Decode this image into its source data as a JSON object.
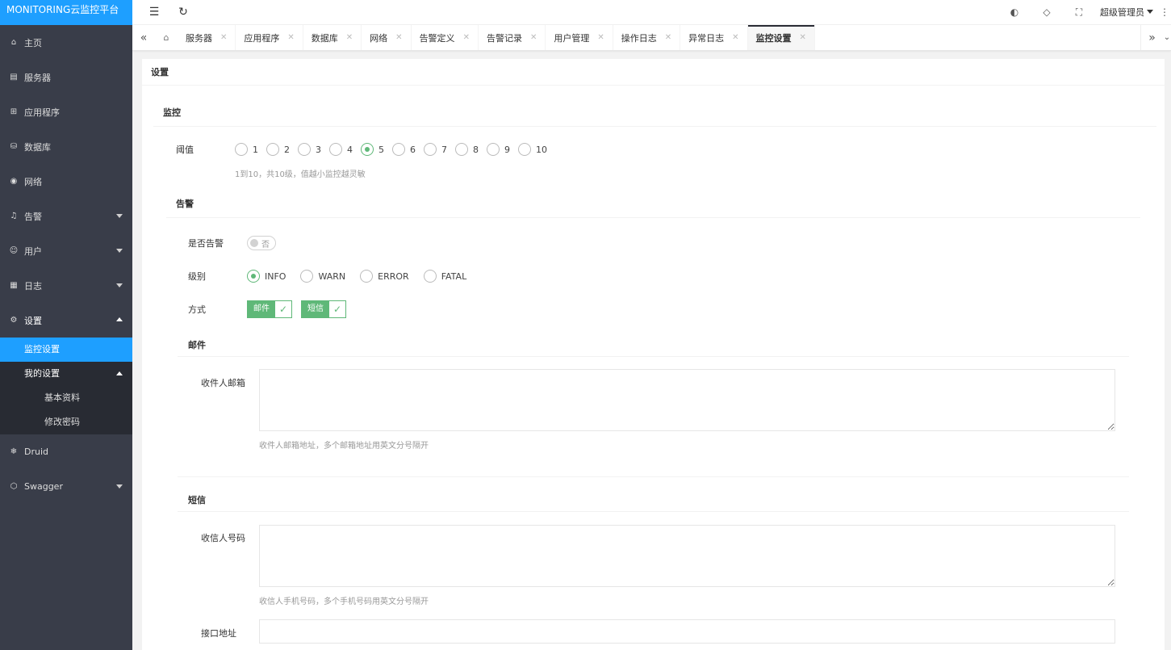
{
  "app": {
    "logo": "MONITORING云监控平台"
  },
  "sidebar": {
    "items": [
      {
        "label": "主页",
        "icon": "home-icon"
      },
      {
        "label": "服务器",
        "icon": "server-icon"
      },
      {
        "label": "应用程序",
        "icon": "app-icon"
      },
      {
        "label": "数据库",
        "icon": "database-icon"
      },
      {
        "label": "网络",
        "icon": "network-icon"
      },
      {
        "label": "告警",
        "icon": "bell-icon"
      },
      {
        "label": "用户",
        "icon": "user-icon"
      },
      {
        "label": "日志",
        "icon": "log-icon"
      },
      {
        "label": "设置",
        "icon": "gear-icon"
      },
      {
        "label": "Druid",
        "icon": "snowflake-icon"
      },
      {
        "label": "Swagger",
        "icon": "cube-icon"
      }
    ],
    "settings_sub": {
      "monitor": "监控设置",
      "my_settings": "我的设置",
      "profile": "基本资料",
      "password": "修改密码"
    }
  },
  "header": {
    "admin": "超级管理员"
  },
  "tabs": [
    {
      "label": "服务器"
    },
    {
      "label": "应用程序"
    },
    {
      "label": "数据库"
    },
    {
      "label": "网络"
    },
    {
      "label": "告警定义"
    },
    {
      "label": "告警记录"
    },
    {
      "label": "用户管理"
    },
    {
      "label": "操作日志"
    },
    {
      "label": "异常日志"
    },
    {
      "label": "监控设置",
      "active": true
    }
  ],
  "panel": {
    "title": "设置"
  },
  "monitor": {
    "title": "监控",
    "threshold_label": "阈值",
    "options": [
      "1",
      "2",
      "3",
      "4",
      "5",
      "6",
      "7",
      "8",
      "9",
      "10"
    ],
    "selected": "5",
    "hint": "1到10，共10级，值越小监控越灵敏"
  },
  "alarm": {
    "title": "告警",
    "enable_label": "是否告警",
    "enable_text": "否",
    "level_label": "级别",
    "levels": [
      "INFO",
      "WARN",
      "ERROR",
      "FATAL"
    ],
    "level_selected": "INFO",
    "method_label": "方式",
    "methods": [
      "邮件",
      "短信"
    ],
    "mail": {
      "title": "邮件",
      "recipient_label": "收件人邮箱",
      "recipient_hint": "收件人邮箱地址，多个邮箱地址用英文分号隔开"
    },
    "sms": {
      "title": "短信",
      "recipient_label": "收信人号码",
      "recipient_hint": "收信人手机号码，多个手机号码用英文分号隔开",
      "api_label": "接口地址"
    }
  },
  "colors": {
    "accent": "#1e9fff",
    "sidebar": "#393d49",
    "green": "#5fb878"
  }
}
